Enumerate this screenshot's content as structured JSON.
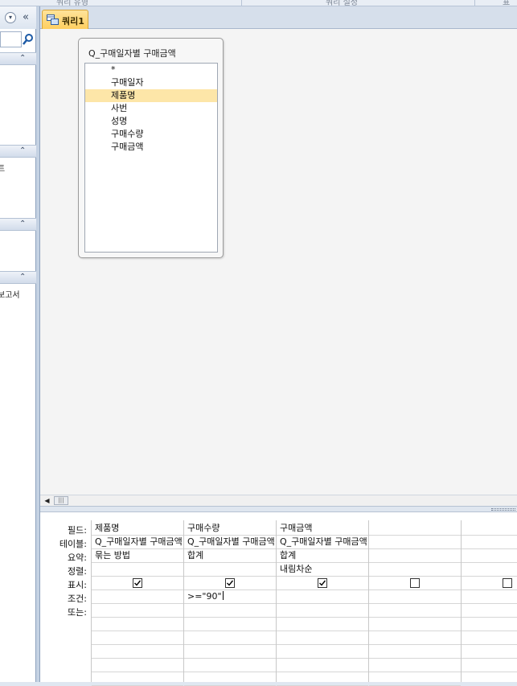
{
  "ribbon": {
    "groups": [
      "쿼리 유형",
      "쿼리 설정",
      "표"
    ]
  },
  "document_tab": {
    "label": "쿼리1"
  },
  "field_list": {
    "title": "Q_구매일자별 구매금액",
    "fields": [
      "*",
      "구매일자",
      "제품명",
      "사번",
      "성명",
      "구매수량",
      "구매금액"
    ],
    "selected_index": 2
  },
  "navigation": {
    "group_item_1": "트",
    "group_item_2": "보고서"
  },
  "grid": {
    "row_labels": [
      "필드:",
      "테이블:",
      "요약:",
      "정렬:",
      "표시:",
      "조건:",
      "또는:"
    ],
    "columns": [
      {
        "field": "제품명",
        "table": "Q_구매일자별 구매금액",
        "total": "묶는 방법",
        "sort": "",
        "show": true,
        "criteria": "",
        "or": ""
      },
      {
        "field": "구매수량",
        "table": "Q_구매일자별 구매금액",
        "total": "합계",
        "sort": "",
        "show": true,
        "criteria": ">=\"90\"",
        "or": ""
      },
      {
        "field": "구매금액",
        "table": "Q_구매일자별 구매금액",
        "total": "합계",
        "sort": "내림차순",
        "show": true,
        "criteria": "",
        "or": ""
      },
      {
        "field": "",
        "table": "",
        "total": "",
        "sort": "",
        "show": false,
        "criteria": "",
        "or": ""
      },
      {
        "field": "",
        "table": "",
        "total": "",
        "sort": "",
        "show": false,
        "criteria": "",
        "or": ""
      }
    ]
  },
  "colors": {
    "tab_active": "#ffcf60",
    "selected_field": "#fde6a8",
    "nav_border": "#8ea2bd"
  }
}
